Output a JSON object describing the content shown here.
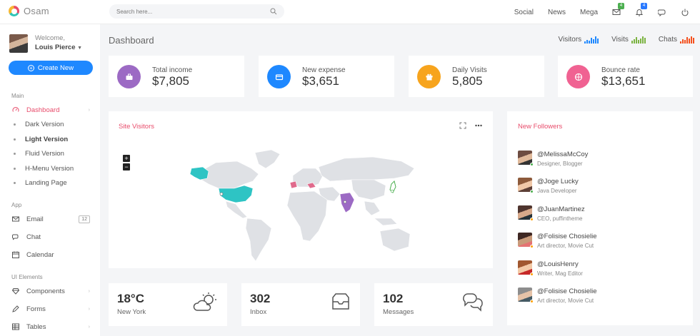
{
  "app": {
    "name": "Osam"
  },
  "search": {
    "placeholder": "Search here..."
  },
  "topnav": {
    "links": [
      "Social",
      "News",
      "Mega"
    ],
    "mail_badge": "4",
    "bell_badge": "4"
  },
  "user": {
    "welcome": "Welcome,",
    "name": "Louis Pierce"
  },
  "sidebar": {
    "create_label": "Create New",
    "main_label": "Main",
    "main_items": [
      "Dashboard",
      "Dark Version",
      "Light Version",
      "Fluid Version",
      "H-Menu Version",
      "Landing Page"
    ],
    "app_label": "App",
    "app_items": [
      "Email",
      "Chat",
      "Calendar"
    ],
    "email_count": "12",
    "ui_label": "UI Elements",
    "ui_items": [
      "Components",
      "Forms",
      "Tables"
    ]
  },
  "page": {
    "title": "Dashboard"
  },
  "stats": [
    {
      "label": "Visitors",
      "color": "#1e88ff"
    },
    {
      "label": "Visits",
      "color": "#7cb342"
    },
    {
      "label": "Chats",
      "color": "#f4511e"
    }
  ],
  "cards": [
    {
      "label": "Total income",
      "value": "$7,805",
      "color": "#9c6ac4",
      "icon": "briefcase-icon"
    },
    {
      "label": "New expense",
      "value": "$3,651",
      "color": "#1e88ff",
      "icon": "credit-card-icon"
    },
    {
      "label": "Daily Visits",
      "value": "5,805",
      "color": "#f7a41d",
      "icon": "gift-icon"
    },
    {
      "label": "Bounce rate",
      "value": "$13,651",
      "color": "#f06292",
      "icon": "globe-icon"
    }
  ],
  "site_visitors": {
    "title": "Site Visitors"
  },
  "followers": {
    "title": "New Followers",
    "items": [
      {
        "name": "@MelissaMcCoy",
        "role": "Designer, Blogger",
        "status": "#4caf50"
      },
      {
        "name": "@Joge Lucky",
        "role": "Java Developer",
        "status": "#4caf50"
      },
      {
        "name": "@JuanMartinez",
        "role": "CEO, puffintheme",
        "status": "#ffa000"
      },
      {
        "name": "@Folisise Chosielie",
        "role": "Art director, Movie Cut",
        "status": "#ffa000"
      },
      {
        "name": "@LouisHenry",
        "role": "Writer, Mag Editor",
        "status": "#ffa000"
      },
      {
        "name": "@Folisise Chosielie",
        "role": "Art director, Movie Cut",
        "status": "#ffa000"
      }
    ]
  },
  "weather": [
    {
      "value": "18°C",
      "label": "New York",
      "icon": "cloud-sun-icon"
    },
    {
      "value": "302",
      "label": "Inbox",
      "icon": "inbox-icon"
    },
    {
      "value": "102",
      "label": "Messages",
      "icon": "chat-bubbles-icon"
    }
  ]
}
